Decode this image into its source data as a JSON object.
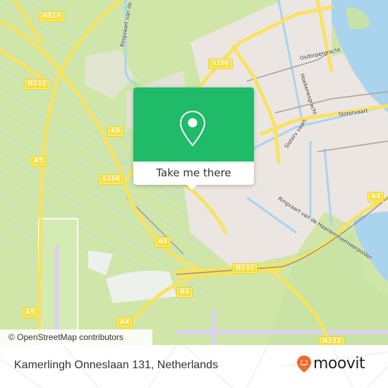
{
  "map": {
    "attribution": "© OpenStreetMap contributors",
    "colors": {
      "land_green": "#cfe6a8",
      "urban": "#ece6e2",
      "water": "#aad3ee",
      "highway": "#f8e262",
      "runway": "#ddd0ee",
      "popup_green": "#1fbb68",
      "brand_orange": "#f26b2a"
    },
    "road_shields": [
      {
        "label": "N519"
      },
      {
        "label": "N232"
      },
      {
        "label": "A9"
      },
      {
        "label": "A5"
      },
      {
        "label": "S106"
      },
      {
        "label": "S106"
      },
      {
        "label": "A9"
      },
      {
        "label": "A4"
      },
      {
        "label": "A5"
      },
      {
        "label": "A4"
      },
      {
        "label": "N232"
      },
      {
        "label": "N232"
      }
    ],
    "street_labels": [
      {
        "label": "Ringvaart van de"
      },
      {
        "label": "Osdorpergracht"
      },
      {
        "label": "Hoekenesgracht"
      },
      {
        "label": "Slotervaart"
      },
      {
        "label": "Sloterv vaart"
      },
      {
        "label": "Ringvaart van de Haarlemmermeerpolder"
      }
    ]
  },
  "popup": {
    "icon": "map-pin-icon",
    "button_label": "Take me there"
  },
  "footer": {
    "address": "Kamerlingh Onneslaan 131, Netherlands",
    "brand": "moovit",
    "brand_icon": "moovit-smile-pin-icon"
  }
}
